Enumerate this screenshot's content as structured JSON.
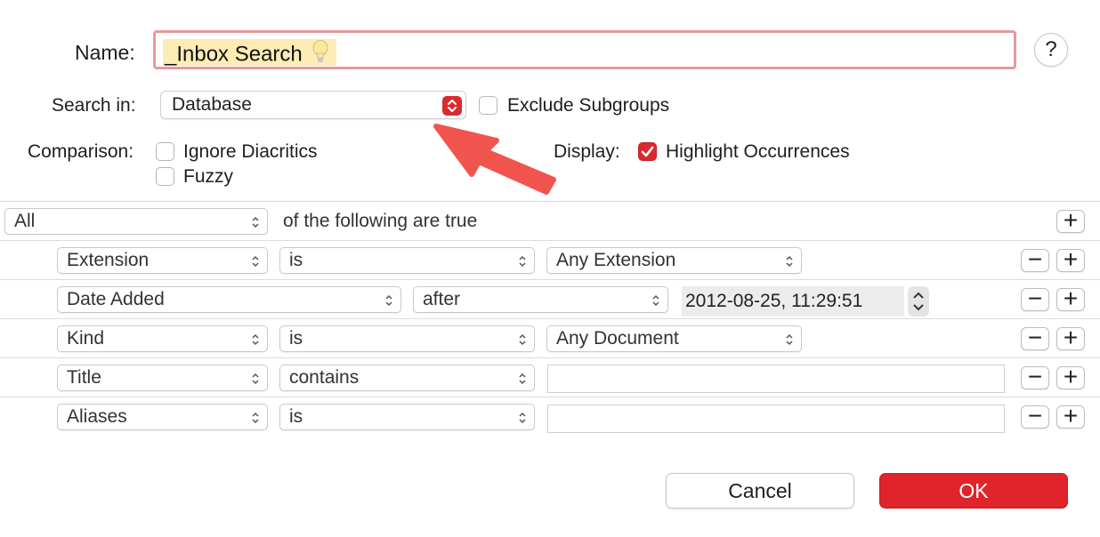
{
  "name_row": {
    "label": "Name:",
    "value": "_Inbox Search"
  },
  "help_label": "?",
  "search_in": {
    "label": "Search in:",
    "selected": "Database",
    "exclude_subgroups": {
      "label": "Exclude Subgroups",
      "checked": false
    }
  },
  "comparison": {
    "label": "Comparison:",
    "ignore_diacritics": {
      "label": "Ignore Diacritics",
      "checked": false
    },
    "fuzzy": {
      "label": "Fuzzy",
      "checked": false
    }
  },
  "display": {
    "label": "Display:",
    "highlight": {
      "label": "Highlight Occurrences",
      "checked": true
    }
  },
  "match": {
    "selected": "All",
    "suffix": "of the following are true"
  },
  "criteria": [
    {
      "field": "Extension",
      "operator": "is",
      "value": "Any Extension"
    },
    {
      "field": "Date Added",
      "operator": "after",
      "value": "2012-08-25, 11:29:51"
    },
    {
      "field": "Kind",
      "operator": "is",
      "value": "Any Document"
    },
    {
      "field": "Title",
      "operator": "contains",
      "value": ""
    },
    {
      "field": "Aliases",
      "operator": "is",
      "value": ""
    }
  ],
  "buttons": {
    "cancel": "Cancel",
    "ok": "OK"
  },
  "colors": {
    "accent": "#e0242b",
    "name_border": "#e6999b",
    "name_highlight": "#fdecb5",
    "arrow": "#f1544e"
  },
  "icons": {
    "plus": "+",
    "minus": "−"
  }
}
